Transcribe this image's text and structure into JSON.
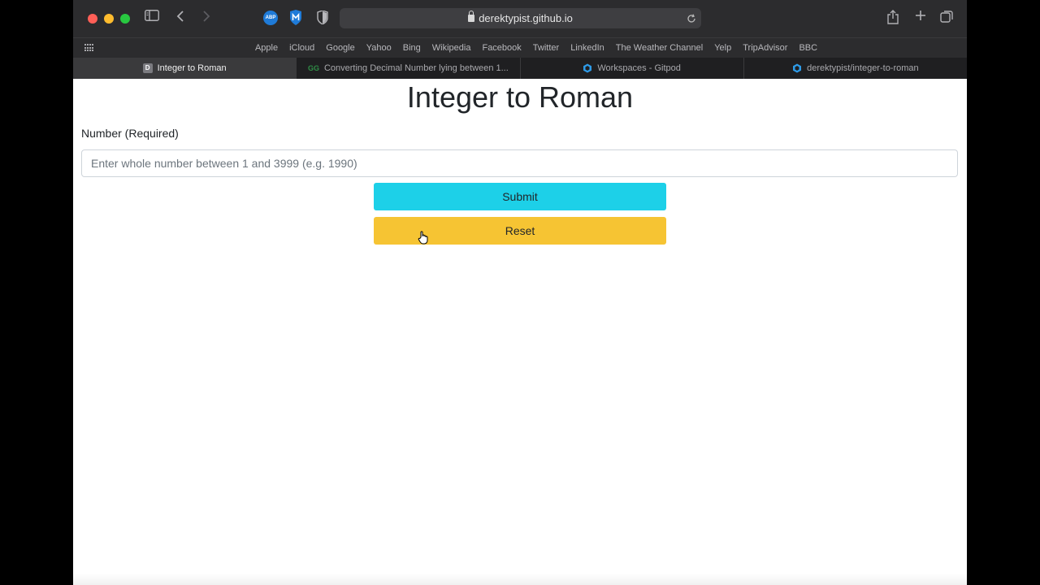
{
  "browser": {
    "url": "derektypist.github.io",
    "bookmarks": [
      "Apple",
      "iCloud",
      "Google",
      "Yahoo",
      "Bing",
      "Wikipedia",
      "Facebook",
      "Twitter",
      "LinkedIn",
      "The Weather Channel",
      "Yelp",
      "TripAdvisor",
      "BBC"
    ],
    "tabs": [
      {
        "label": "Integer to Roman",
        "icon": "letter-d-icon",
        "active": true
      },
      {
        "label": "Converting Decimal Number lying between 1...",
        "icon": "geeksforgeeks-icon",
        "active": false
      },
      {
        "label": "Workspaces - Gitpod",
        "icon": "gitpod-icon",
        "active": false
      },
      {
        "label": "derektypist/integer-to-roman",
        "icon": "gitpod-icon",
        "active": false
      }
    ],
    "abp_label": "ABP",
    "favicon_letter": "D",
    "gfg_mark": "GG"
  },
  "page": {
    "title": "Integer to Roman",
    "number_label": "Number (Required)",
    "number_placeholder": "Enter whole number between 1 and 3999 (e.g. 1990)",
    "number_value": "",
    "submit_label": "Submit",
    "reset_label": "Reset"
  },
  "colors": {
    "submit": "#1dd0e8",
    "reset": "#f6c433",
    "toolbar": "#2c2c2e"
  }
}
